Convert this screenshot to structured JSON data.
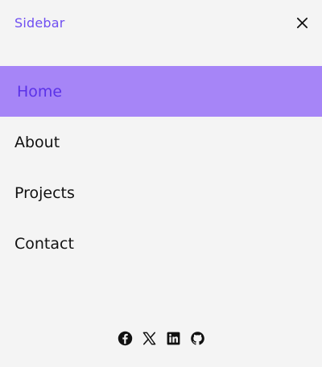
{
  "sidebar": {
    "title": "Sidebar",
    "close_icon": "close-icon",
    "accent_color": "#6f4ef2",
    "active_bg_color": "#a685f7",
    "nav": [
      {
        "label": "Home",
        "active": true
      },
      {
        "label": "About",
        "active": false
      },
      {
        "label": "Projects",
        "active": false
      },
      {
        "label": "Contact",
        "active": false
      }
    ],
    "social_icons": [
      "facebook-icon",
      "x-twitter-icon",
      "linkedin-icon",
      "github-icon"
    ]
  }
}
